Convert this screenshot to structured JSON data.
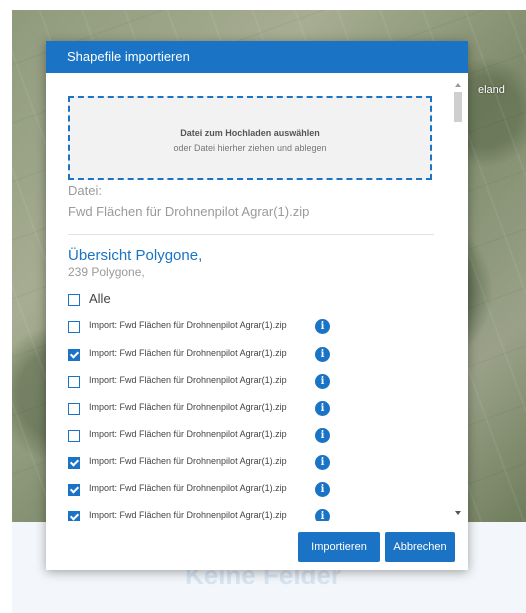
{
  "map": {
    "place_label": "eland"
  },
  "page": {
    "empty_text": "Keine Felder"
  },
  "dialog": {
    "title": "Shapefile importieren",
    "dropzone": {
      "title": "Datei zum Hochladen auswählen",
      "subtitle": "oder Datei hierher ziehen und ablegen"
    },
    "file_label": "Datei:",
    "file_name": "Fwd Flächen für Drohnenpilot Agrar(1).zip",
    "overview_title": "Übersicht Polygone,",
    "overview_count": "239 Polygone,",
    "select_all_label": "Alle",
    "select_all_checked": false,
    "polygons": [
      {
        "label": "Import: Fwd Flächen für Drohnenpilot Agrar(1).zip",
        "checked": false
      },
      {
        "label": "Import: Fwd Flächen für Drohnenpilot Agrar(1).zip",
        "checked": true
      },
      {
        "label": "Import: Fwd Flächen für Drohnenpilot Agrar(1).zip",
        "checked": false
      },
      {
        "label": "Import: Fwd Flächen für Drohnenpilot Agrar(1).zip",
        "checked": false
      },
      {
        "label": "Import: Fwd Flächen für Drohnenpilot Agrar(1).zip",
        "checked": false
      },
      {
        "label": "Import: Fwd Flächen für Drohnenpilot Agrar(1).zip",
        "checked": true
      },
      {
        "label": "Import: Fwd Flächen für Drohnenpilot Agrar(1).zip",
        "checked": true
      },
      {
        "label": "Import: Fwd Flächen für Drohnenpilot Agrar(1).zip",
        "checked": true
      }
    ],
    "info_icon_glyph": "i",
    "import_button": "Importieren",
    "cancel_button": "Abbrechen"
  },
  "colors": {
    "accent": "#1a73c4"
  }
}
